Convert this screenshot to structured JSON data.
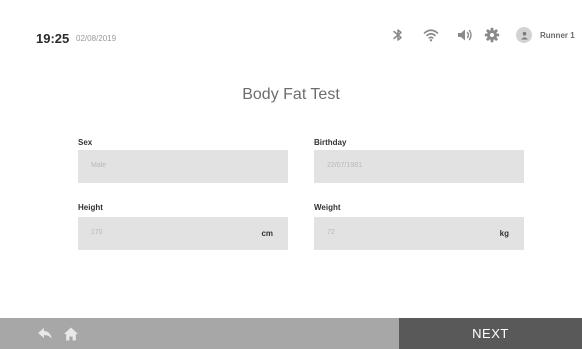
{
  "status_bar": {
    "time": "19:25",
    "date": "02/08/2019",
    "icons": [
      "bluetooth-icon",
      "wifi-icon",
      "volume-icon",
      "gear-icon",
      "user-icon"
    ],
    "user_name": "Runner 1"
  },
  "page": {
    "title": "Body Fat Test"
  },
  "form": {
    "sex": {
      "label": "Sex",
      "value": "Male"
    },
    "birthday": {
      "label": "Birthday",
      "value": "22/07/1981"
    },
    "height": {
      "label": "Height",
      "value": "170",
      "unit": "cm"
    },
    "weight": {
      "label": "Weight",
      "value": "72",
      "unit": "kg"
    }
  },
  "bottom_bar": {
    "back_icon": "back-arrow-icon",
    "home_icon": "home-icon",
    "next_label": "NEXT"
  },
  "colors": {
    "field_bg": "#e2e2e2",
    "bottom_bar": "#a7a7a7",
    "next_button": "#595959",
    "text_dark": "#2a2a2a",
    "text_muted": "#b8b8b8"
  }
}
